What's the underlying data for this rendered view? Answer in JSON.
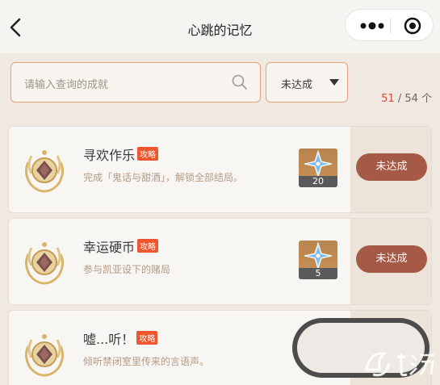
{
  "header": {
    "title": "心跳的记忆",
    "back_icon": "chevron-left-icon",
    "more_icon": "more-dots-icon",
    "close_icon": "target-icon"
  },
  "filter": {
    "search_placeholder": "请输入查询的成就",
    "status_selected": "未达成",
    "count_current": "51",
    "count_total": "/ 54 个"
  },
  "achievements": [
    {
      "name": "寻欢作乐",
      "tag": "攻略",
      "desc": "完成「鬼话与甜酒」，解锁全部结局。",
      "reward_qty": "20",
      "status": "未达成"
    },
    {
      "name": "幸运硬币",
      "tag": "攻略",
      "desc": "参与凯亚设下的赌局",
      "reward_qty": "5",
      "status": "未达成"
    },
    {
      "name": "嘘...听！",
      "tag": "攻略",
      "desc": "倾听禁闭室里传来的言语声。"
    }
  ],
  "colors": {
    "accent_border": "#e4a27a",
    "button_bg": "#a55a47",
    "tag_bg": "#f0562d",
    "count_highlight": "#d94b3a"
  }
}
